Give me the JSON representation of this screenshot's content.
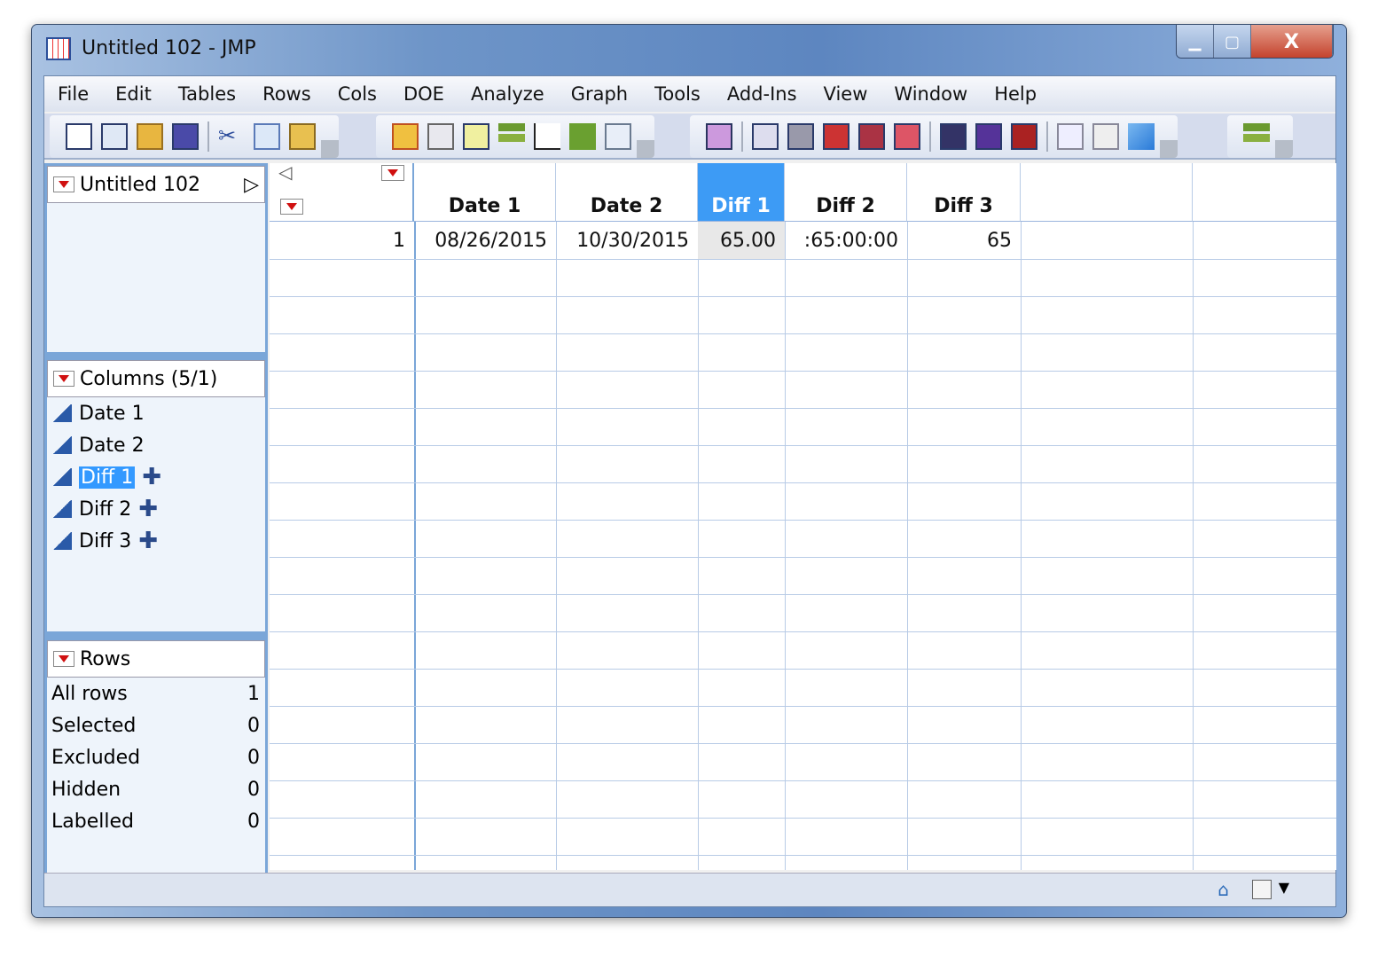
{
  "window": {
    "title": "Untitled 102 - JMP"
  },
  "menu": [
    "File",
    "Edit",
    "Tables",
    "Rows",
    "Cols",
    "DOE",
    "Analyze",
    "Graph",
    "Tools",
    "Add-Ins",
    "View",
    "Window",
    "Help"
  ],
  "table_panel": {
    "title": "Untitled 102"
  },
  "columns_panel": {
    "title": "Columns (5/1)",
    "items": [
      "Date 1",
      "Date 2",
      "Diff 1",
      "Diff 2",
      "Diff 3"
    ],
    "selected": "Diff 1"
  },
  "rows_panel": {
    "title": "Rows",
    "items": [
      {
        "label": "All rows",
        "value": "1"
      },
      {
        "label": "Selected",
        "value": "0"
      },
      {
        "label": "Excluded",
        "value": "0"
      },
      {
        "label": "Hidden",
        "value": "0"
      },
      {
        "label": "Labelled",
        "value": "0"
      }
    ]
  },
  "grid": {
    "headers": [
      "Date 1",
      "Date 2",
      "Diff 1",
      "Diff 2",
      "Diff 3"
    ],
    "rows": [
      {
        "num": "1",
        "cells": [
          "08/26/2015",
          "10/30/2015",
          "65.00",
          ":65:00:00",
          "65"
        ]
      }
    ]
  }
}
